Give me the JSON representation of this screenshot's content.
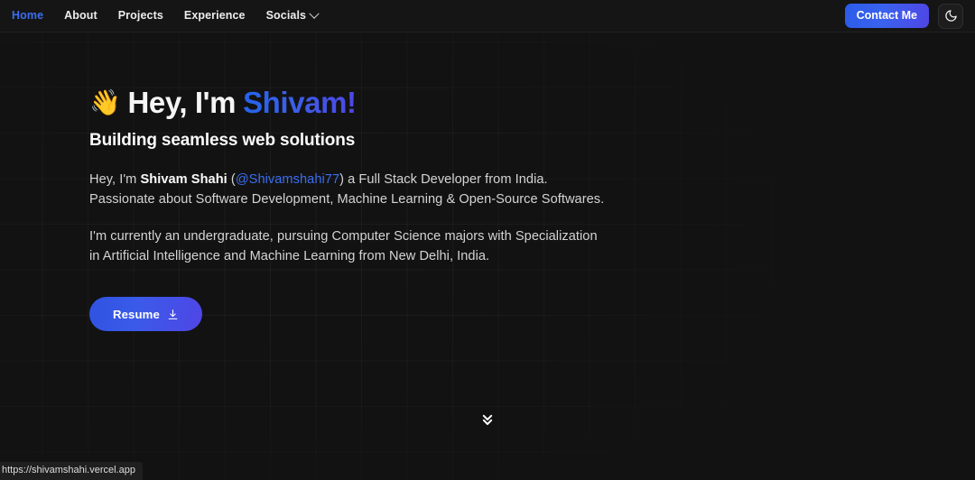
{
  "navbar": {
    "links": [
      {
        "label": "Home",
        "active": true
      },
      {
        "label": "About",
        "active": false
      },
      {
        "label": "Projects",
        "active": false
      },
      {
        "label": "Experience",
        "active": false
      }
    ],
    "socials_label": "Socials",
    "socials_icon": "chevron-down-icon",
    "contact_label": "Contact Me",
    "theme_icon": "moon-icon",
    "accent_color": "#3b6ef0"
  },
  "hero": {
    "wave_emoji": "👋",
    "greeting": "Hey, I'm",
    "name": "Shivam!",
    "subtitle": "Building seamless web solutions",
    "paragraph1": {
      "part1": "Hey, I'm ",
      "strong": "Shivam Shahi",
      "part2": " (",
      "link": "@Shivamshahi77",
      "part3": ") a Full Stack Developer from India. Passionate about Software Development, Machine Learning & Open-Source Softwares."
    },
    "paragraph2": "I'm currently an undergraduate, pursuing Computer Science majors with Specialization in Artificial Intelligence and Machine Learning from New Delhi, India.",
    "resume_label": "Resume",
    "resume_icon": "download-icon",
    "gradient_from": "#2563eb",
    "gradient_to": "#4f46e5"
  },
  "scroll_cue": {
    "icon": "chevrons-down-icon"
  },
  "status_bar": {
    "url": "https://shivamshahi.vercel.app"
  }
}
